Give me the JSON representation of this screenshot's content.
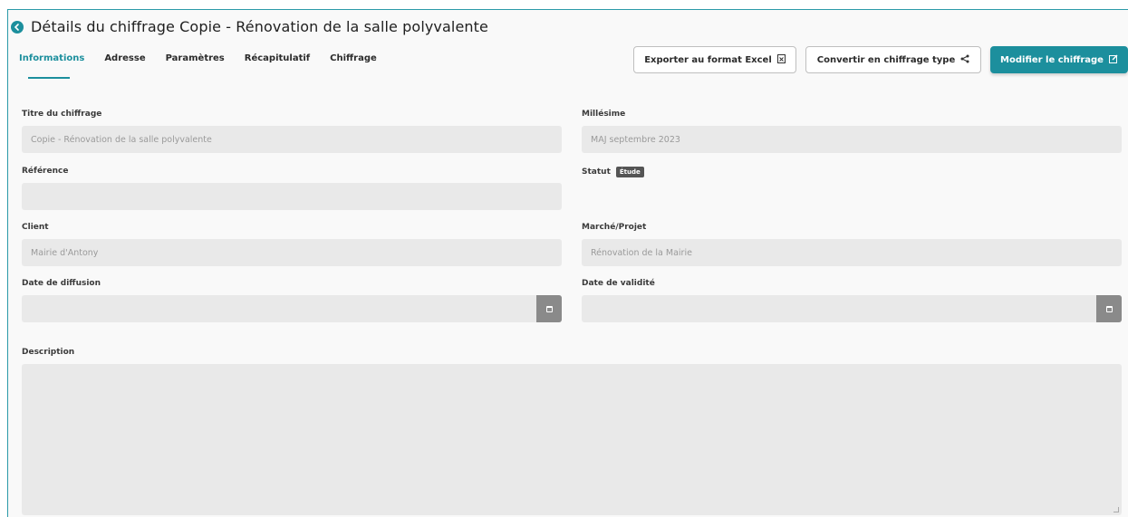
{
  "header": {
    "title": "Détails du chiffrage Copie - Rénovation de la salle polyvalente"
  },
  "tabs": [
    {
      "label": "Informations"
    },
    {
      "label": "Adresse"
    },
    {
      "label": "Paramètres"
    },
    {
      "label": "Récapitulatif"
    },
    {
      "label": "Chiffrage"
    }
  ],
  "actions": {
    "export_label": "Exporter au format Excel",
    "convert_label": "Convertir en chiffrage type",
    "edit_label": "Modifier le chiffrage"
  },
  "form": {
    "titre": {
      "label": "Titre du chiffrage",
      "value": "Copie - Rénovation de la salle polyvalente"
    },
    "millesime": {
      "label": "Millésime",
      "value": "MAJ septembre 2023"
    },
    "reference": {
      "label": "Référence",
      "value": ""
    },
    "statut": {
      "label": "Statut",
      "badge": "Étude"
    },
    "client": {
      "label": "Client",
      "value": "Mairie d'Antony"
    },
    "marche": {
      "label": "Marché/Projet",
      "value": "Rénovation de la Mairie"
    },
    "date_diffusion": {
      "label": "Date de diffusion",
      "value": ""
    },
    "date_validite": {
      "label": "Date de validité",
      "value": ""
    },
    "description": {
      "label": "Description",
      "value": ""
    }
  },
  "colors": {
    "accent": "#1c8f9d",
    "input_bg": "#e9e9e9",
    "page_bg": "#f9f9f9"
  },
  "icons": {
    "back": "arrow-left-circle-icon",
    "export": "file-excel-icon",
    "convert": "share-icon",
    "edit": "edit-icon",
    "calendar": "calendar-icon"
  }
}
